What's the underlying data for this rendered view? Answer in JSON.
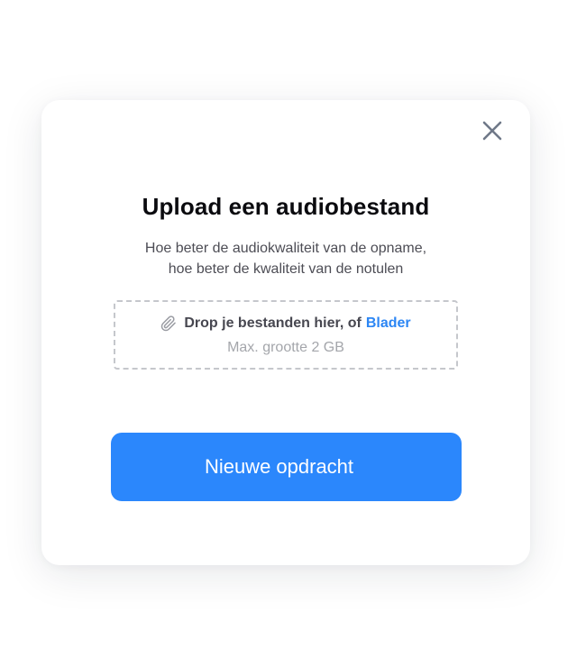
{
  "modal": {
    "close_icon": "close-icon",
    "title": "Upload een audiobestand",
    "subtitle_line1": "Hoe beter de audiokwaliteit van de opname,",
    "subtitle_line2": "hoe beter de kwaliteit van de notulen",
    "dropzone": {
      "icon": "paperclip-icon",
      "drop_text": "Drop je bestanden hier, of",
      "browse_label": "Blader",
      "max_size": "Max. grootte 2 GB"
    },
    "primary_button_label": "Nieuwe opdracht"
  },
  "colors": {
    "accent": "#2b87fc",
    "link": "#2c86f4",
    "title": "#0b0b0f",
    "muted": "#a4a6ab",
    "close_icon": "#6f7888"
  }
}
